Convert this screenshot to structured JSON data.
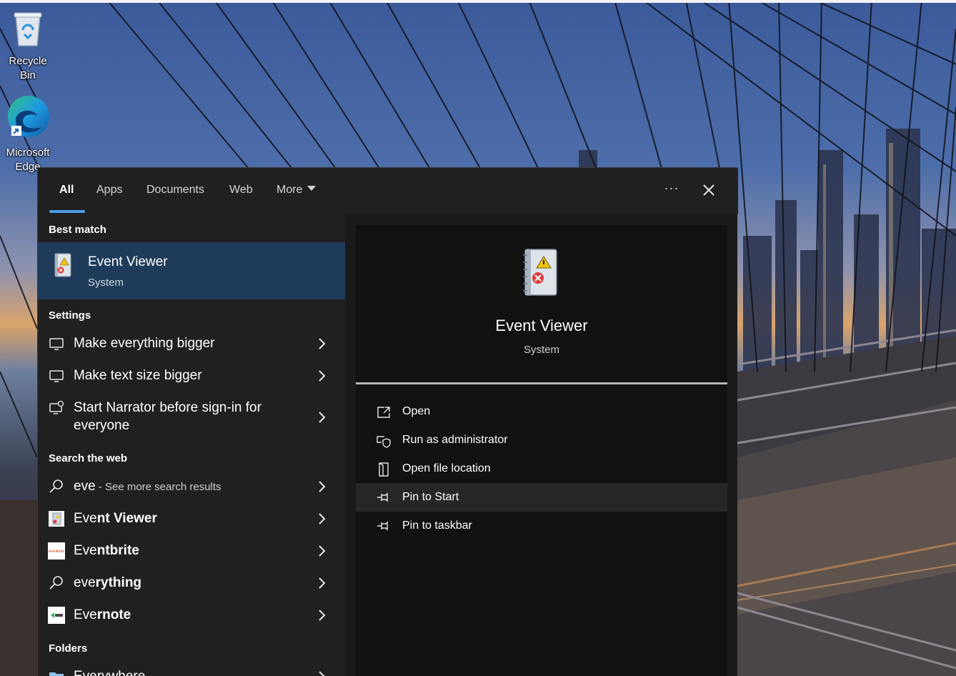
{
  "desktop": {
    "icons": [
      {
        "label": "Recycle Bin",
        "icon": "recycle-bin-icon"
      },
      {
        "label": "Microsoft Edge",
        "icon": "edge-icon"
      }
    ]
  },
  "search": {
    "tabs": [
      {
        "label": "All",
        "active": true
      },
      {
        "label": "Apps"
      },
      {
        "label": "Documents"
      },
      {
        "label": "Web"
      },
      {
        "label": "More"
      }
    ],
    "more_options_glyph": "···",
    "accent_color": "#4c9be8",
    "sections": {
      "best_match": "Best match",
      "settings": "Settings",
      "search_web": "Search the web",
      "folders": "Folders"
    },
    "best_match": {
      "title": "Event Viewer",
      "subtitle": "System",
      "icon": "event-viewer-icon"
    },
    "settings_items": [
      {
        "label": "Make everything bigger",
        "icon": "monitor-icon"
      },
      {
        "label": "Make text size bigger",
        "icon": "monitor-icon"
      },
      {
        "label_line1": "Start Narrator before sign-in for",
        "label_line2": "everyone",
        "icon": "narrator-icon"
      }
    ],
    "web_items": [
      {
        "typed": "eve",
        "hint": " - See more search results",
        "icon": "search-icon"
      },
      {
        "typed": "Eve",
        "rest": "nt Viewer",
        "icon": "event-viewer-icon"
      },
      {
        "typed": "Eve",
        "rest": "ntbrite",
        "icon": "eventbrite-icon"
      },
      {
        "typed": "eve",
        "rest": "rything",
        "icon": "search-icon"
      },
      {
        "typed": "Eve",
        "rest": "rnote",
        "icon": "evernote-icon"
      }
    ],
    "folder_items": [
      {
        "label": "Everywhere",
        "icon": "folder-icon"
      }
    ]
  },
  "preview": {
    "title": "Event Viewer",
    "subtitle": "System",
    "actions": [
      {
        "label": "Open",
        "icon": "open-icon"
      },
      {
        "label": "Run as administrator",
        "icon": "shield-icon"
      },
      {
        "label": "Open file location",
        "icon": "file-location-icon"
      },
      {
        "label": "Pin to Start",
        "icon": "pin-icon",
        "hovered": true
      },
      {
        "label": "Pin to taskbar",
        "icon": "pin-icon"
      }
    ]
  }
}
